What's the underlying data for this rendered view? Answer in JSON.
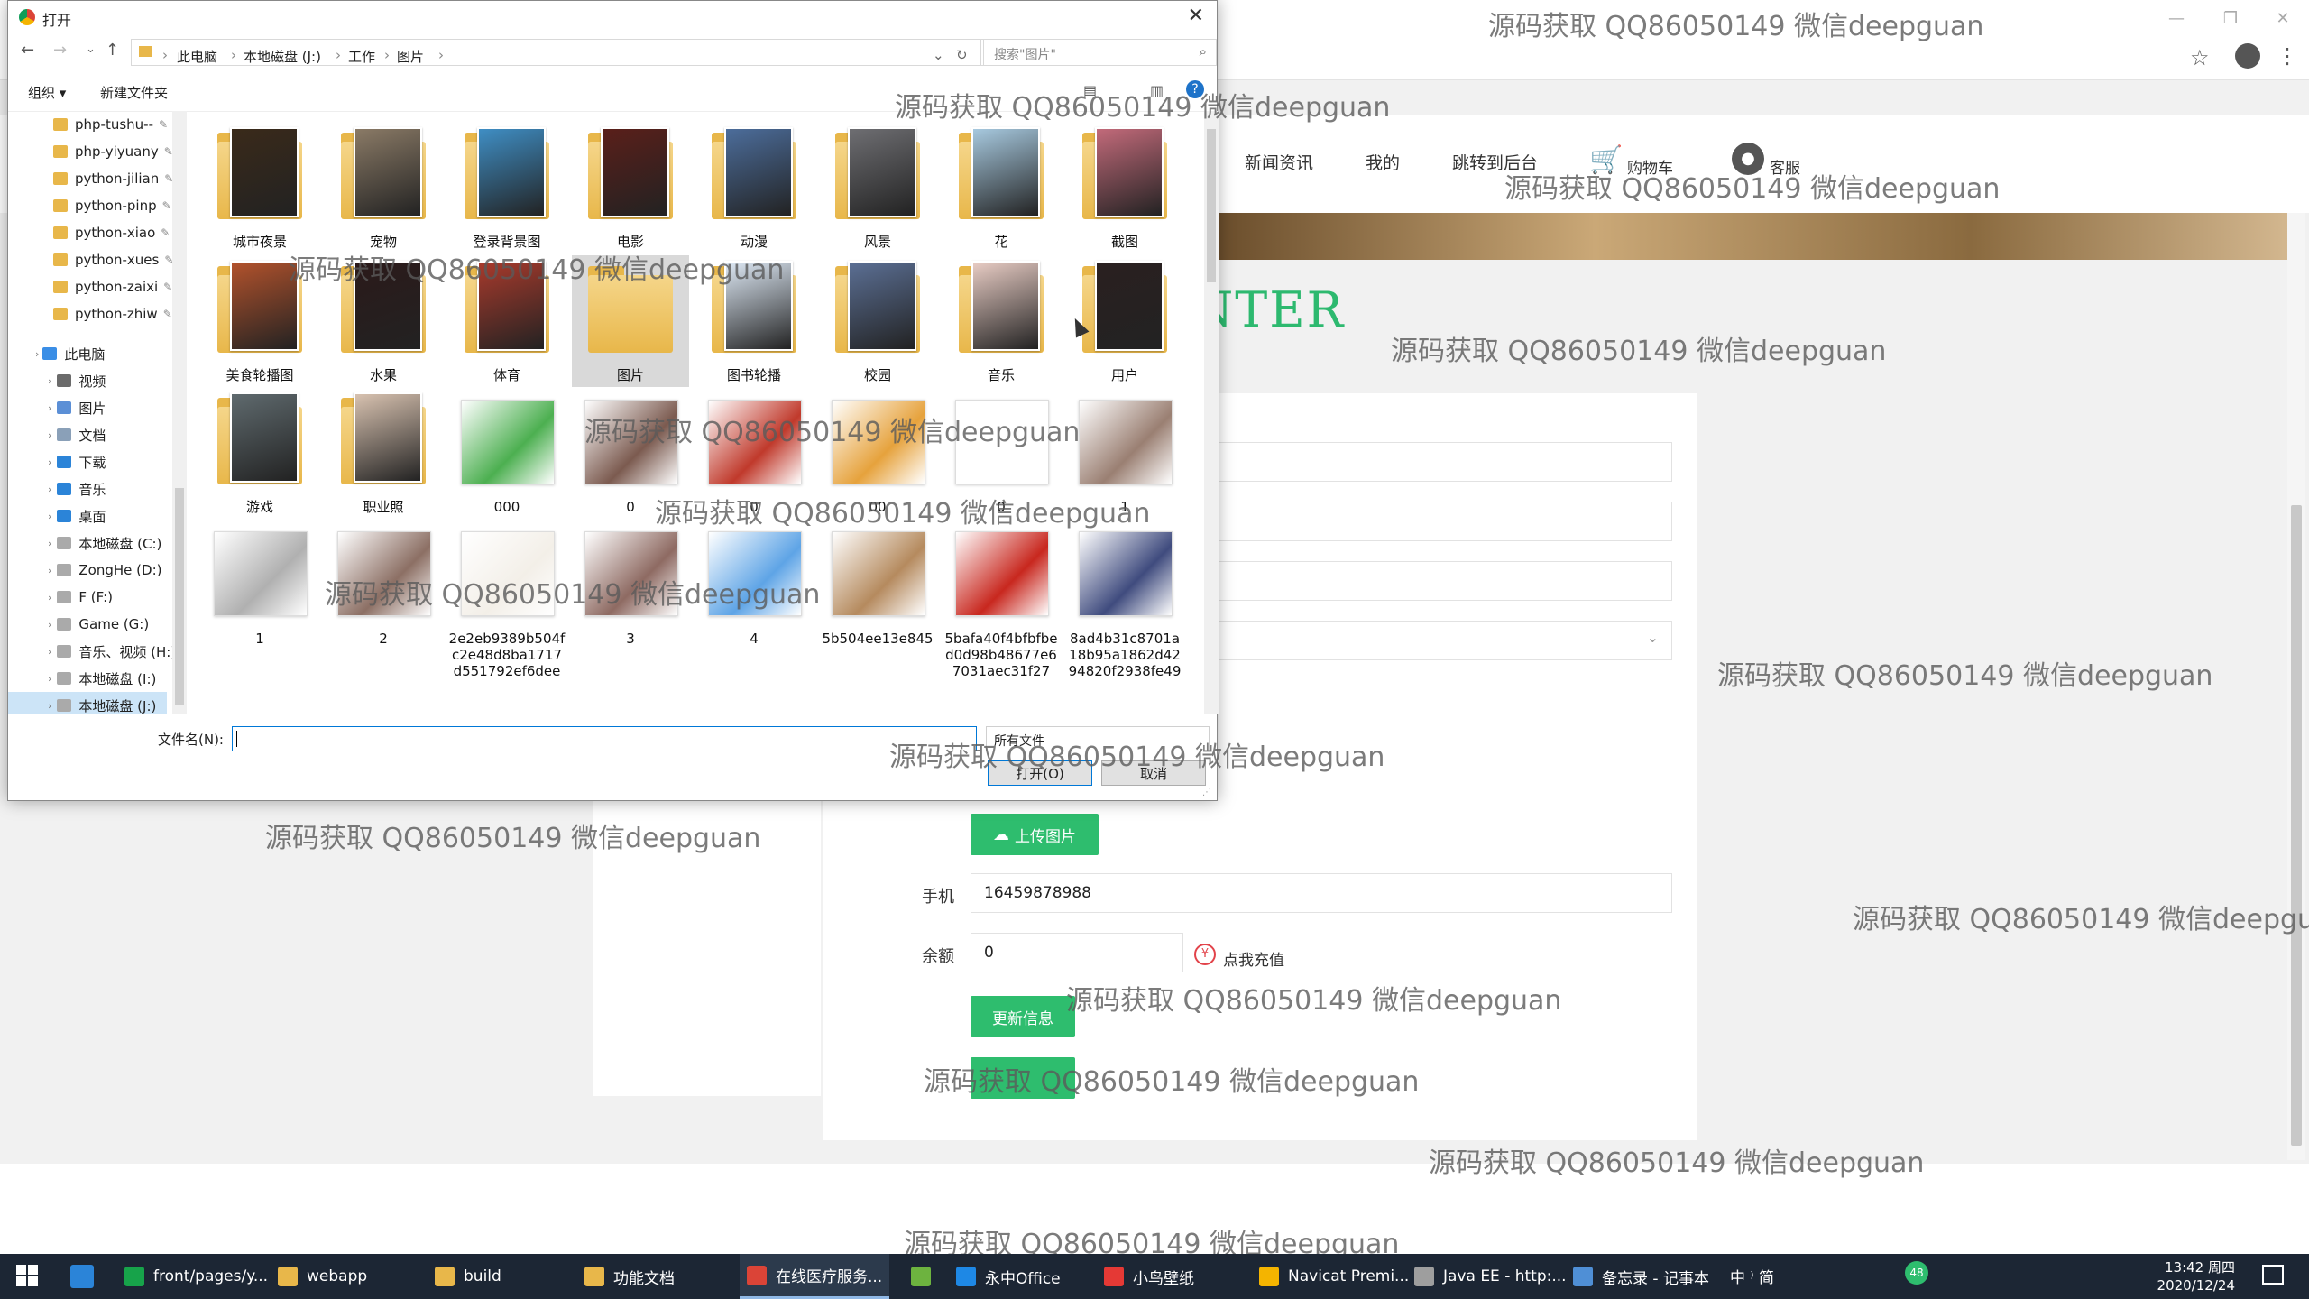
{
  "dialog": {
    "title": "打开",
    "breadcrumb": [
      "此电脑",
      "本地磁盘 (J:)",
      "工作",
      "图片"
    ],
    "search_placeholder": "搜索\"图片\"",
    "organize_label": "组织 ▾",
    "new_folder_label": "新建文件夹",
    "tree_pinned": [
      "php-tushu--",
      "php-yiyuany",
      "python-jilian",
      "python-pinp",
      "python-xiao",
      "python-xues",
      "python-zaixi",
      "python-zhiw"
    ],
    "tree_pc_label": "此电脑",
    "tree_pc_items": [
      "视频",
      "图片",
      "文档",
      "下载",
      "音乐",
      "桌面",
      "本地磁盘 (C:)",
      "ZongHe (D:)",
      "F (F:)",
      "Game (G:)",
      "音乐、视频 (H:)",
      "本地磁盘 (I:)",
      "本地磁盘 (J:)"
    ],
    "files": [
      {
        "name": "城市夜景",
        "kind": "folder",
        "color": "#3a2a1a"
      },
      {
        "name": "宠物",
        "kind": "folder",
        "color": "#8a7a66"
      },
      {
        "name": "登录背景图",
        "kind": "folder",
        "color": "#3f8ec4"
      },
      {
        "name": "电影",
        "kind": "folder",
        "color": "#5a1f1a"
      },
      {
        "name": "动漫",
        "kind": "folder",
        "color": "#4c6d9b"
      },
      {
        "name": "风景",
        "kind": "folder",
        "color": "#6e6e72"
      },
      {
        "name": "花",
        "kind": "folder",
        "color": "#a7c9df"
      },
      {
        "name": "截图",
        "kind": "folder",
        "color": "#c26a7a"
      },
      {
        "name": "美食轮播图",
        "kind": "folder",
        "color": "#b2522c"
      },
      {
        "name": "水果",
        "kind": "folder",
        "color": "#2b1a1a"
      },
      {
        "name": "体育",
        "kind": "folder",
        "color": "#a83a2c"
      },
      {
        "name": "图片",
        "kind": "folder",
        "color": ""
      },
      {
        "name": "图书轮播",
        "kind": "folder",
        "color": "#dde8f4"
      },
      {
        "name": "校园",
        "kind": "folder",
        "color": "#5b6f94"
      },
      {
        "name": "音乐",
        "kind": "folder",
        "color": "#e8ccc4"
      },
      {
        "name": "用户",
        "kind": "folder",
        "color": "#2a2020"
      },
      {
        "name": "游戏",
        "kind": "folder",
        "color": "#5f6a6e"
      },
      {
        "name": "职业照",
        "kind": "folder",
        "color": "#d8c2b0"
      },
      {
        "name": "000",
        "kind": "file",
        "color": "#4caf50"
      },
      {
        "name": "0",
        "kind": "file",
        "color": "#7b5a4f"
      },
      {
        "name": "0",
        "kind": "file",
        "color": "#c0392b"
      },
      {
        "name": "00",
        "kind": "file",
        "color": "#e6a23c"
      },
      {
        "name": "0",
        "kind": "file",
        "color": "#ffffff"
      },
      {
        "name": "1",
        "kind": "file",
        "color": "#9a7f72"
      },
      {
        "name": "1",
        "kind": "file",
        "color": "#b0b0b0"
      },
      {
        "name": "2",
        "kind": "file",
        "color": "#8c6f64"
      },
      {
        "name": "2e2eb9389b504fc2e48d8ba1717d551792ef6dee",
        "kind": "file",
        "color": "#f3efe8"
      },
      {
        "name": "3",
        "kind": "file",
        "color": "#8e6a62"
      },
      {
        "name": "4",
        "kind": "file",
        "color": "#5ea4e6"
      },
      {
        "name": "5b504ee13e845",
        "kind": "file",
        "color": "#b58a5e"
      },
      {
        "name": "5bafa40f4bfbfbed0d98b48677e67031aec31f27",
        "kind": "file",
        "color": "#c8271e"
      },
      {
        "name": "8ad4b31c8701a18b95a1862d4294820f2938fe49",
        "kind": "file",
        "color": "#3f4b7e"
      }
    ],
    "filename_label": "文件名(N):",
    "filename_value": "",
    "filetype_label": "所有文件",
    "open_button": "打开(O)",
    "cancel_button": "取消"
  },
  "page": {
    "nav_items": [
      "新闻资讯",
      "我的",
      "跳转到后台",
      "购物车",
      "客服"
    ],
    "title_fragment": "NTER",
    "upload_button": "上传图片",
    "phone_label": "手机",
    "phone_value": "16459878988",
    "balance_label": "余额",
    "balance_value": "0",
    "recharge_label": "点我充值",
    "update_button": "更新信息"
  },
  "watermark": "源码获取 QQ86050149 微信deepguan",
  "taskbar": {
    "items": [
      "front/pages/y...",
      "webapp",
      "build",
      "功能文档",
      "在线医疗服务...",
      "",
      "永中Office",
      "小鸟壁纸",
      "Navicat Premi...",
      "Java EE - http:...",
      "备忘录 - 记事本"
    ],
    "tray_text": "中 ⁾ 简",
    "time": "13:42 周四",
    "date": "2020/12/24",
    "badge": "48"
  }
}
